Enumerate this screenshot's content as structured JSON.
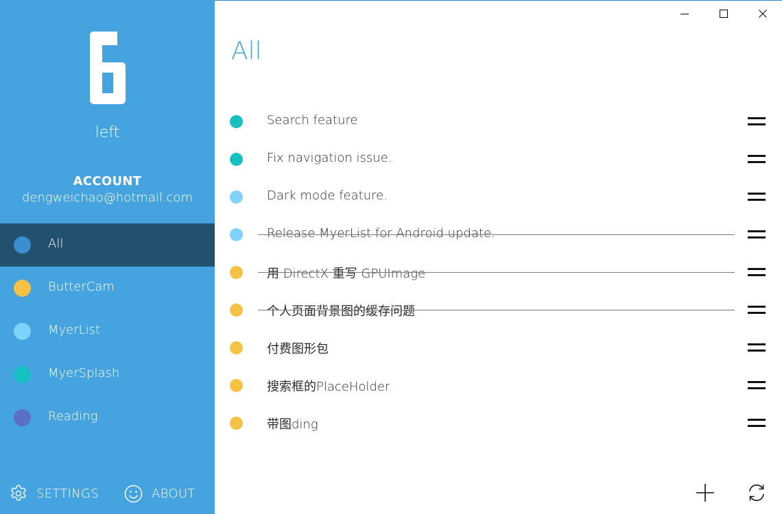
{
  "sidebar": {
    "count": "6",
    "count_caption": "left",
    "account_title": "ACCOUNT",
    "account_email": "dengweichao@hotmail.com",
    "categories": [
      {
        "label": "All",
        "color": "#3c8fcf",
        "selected": true
      },
      {
        "label": "ButterCam",
        "color": "#f6c244",
        "selected": false
      },
      {
        "label": "MyerList",
        "color": "#7ed3fb",
        "selected": false
      },
      {
        "label": "MyerSplash",
        "color": "#15c0c0",
        "selected": false
      },
      {
        "label": "Reading",
        "color": "#5b6fc4",
        "selected": false
      }
    ],
    "settings_label": "SETTINGS",
    "about_label": "ABOUT"
  },
  "window": {
    "minimize_icon": "minimize-icon",
    "maximize_icon": "maximize-icon",
    "close_icon": "close-icon"
  },
  "main": {
    "title": "All",
    "todos": [
      {
        "text": "Search feature",
        "color": "#15c0c0",
        "done": false
      },
      {
        "text": "Fix navigation issue.",
        "color": "#15c0c0",
        "done": false
      },
      {
        "text": "Dark mode feature.",
        "color": "#7ed3fb",
        "done": false
      },
      {
        "text": "Release MyerList for Android update.",
        "color": "#7ed3fb",
        "done": true
      },
      {
        "text": "用 DirectX 重写 GPUImage",
        "color": "#f6c244",
        "done": true
      },
      {
        "text": "个人页面背景图的缓存问题",
        "color": "#f6c244",
        "done": true
      },
      {
        "text": "付费图形包",
        "color": "#f6c244",
        "done": false
      },
      {
        "text": "搜索框的PlaceHolder",
        "color": "#f6c244",
        "done": false
      },
      {
        "text": "带图ding",
        "color": "#f6c244",
        "done": false
      }
    ],
    "add_icon": "plus-icon",
    "sync_icon": "sync-icon"
  }
}
